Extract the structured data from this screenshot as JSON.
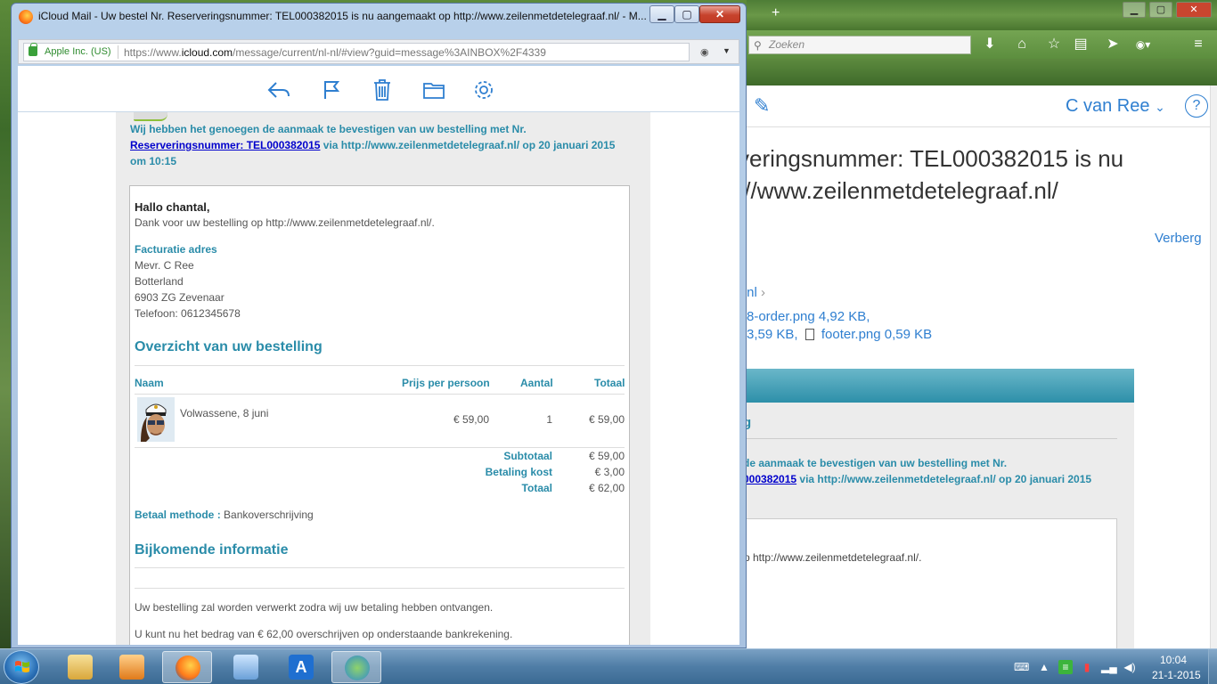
{
  "background_browser": {
    "search_placeholder": "Zoeken",
    "user_name": "C van Ree",
    "user_chevron": "⌄",
    "help_symbol": "?",
    "subject_line1": "veringsnummer: TEL000382015 is nu",
    "subject_line2": "://www.zeilenmetdetelegraaf.nl/",
    "hide_label": "Verberg",
    "from_fragment": ".nl",
    "attachment_line1": "8-order.png 4,92 KB,",
    "attachment_line2_a": "3,59 KB,",
    "attachment_line2_b": "footer.png 0,59 KB",
    "mail_heading_fragment": "g",
    "confirm_line1": "de aanmaak te bevestigen van uw bestelling met Nr.",
    "confirm_link": "000382015",
    "confirm_line2_rest": " via http://www.zeilenmetdetelegraaf.nl/ op 20 januari 2015",
    "box_text": "p http://www.zeilenmetdetelegraaf.nl/."
  },
  "popup": {
    "title": "iCloud Mail - Uw bestel Nr. Reserveringsnummer: TEL000382015 is nu aangemaakt op http://www.zeilenmetdetelegraaf.nl/ - M...",
    "controls": {
      "minimize": "▁",
      "maximize": "▢",
      "close": "✕"
    },
    "identity": "Apple Inc. (US)",
    "url_prefix": "https://www.",
    "url_domain": "icloud.com",
    "url_rest": "/message/current/nl-nl/#view?guid=message%3AINBOX%2F4339"
  },
  "email": {
    "confirm_line1": "Wij hebben het genoegen de aanmaak te bevestigen van uw bestelling met Nr.",
    "confirm_link": "Reserveringsnummer: TEL000382015",
    "confirm_line2_rest": " via http://www.zeilenmetdetelegraaf.nl/ op 20 januari 2015",
    "confirm_line3": "om 10:15",
    "greeting": "Hallo chantal,",
    "thanks": "Dank voor uw bestelling op http://www.zeilenmetdetelegraaf.nl/.",
    "billing_heading": "Facturatie adres",
    "address": [
      "Mevr. C Ree",
      "Botterland",
      "6903 ZG Zevenaar",
      "Telefoon: 0612345678"
    ],
    "overview_heading": "Overzicht van uw bestelling",
    "columns": {
      "name": "Naam",
      "price": "Prijs per persoon",
      "qty": "Aantal",
      "total": "Totaal"
    },
    "item": {
      "name": "Volwassene, 8 juni",
      "price": "€ 59,00",
      "qty": "1",
      "total": "€ 59,00"
    },
    "subtotal_label": "Subtotaal",
    "subtotal_value": "€ 59,00",
    "fee_label": "Betaling kost",
    "fee_value": "€ 3,00",
    "total_label": "Totaal",
    "total_value": "€ 62,00",
    "payment_label": "Betaal methode :",
    "payment_value": " Bankoverschrijving",
    "extra_heading": "Bijkomende informatie",
    "info1": "Uw bestelling zal worden verwerkt zodra wij uw betaling hebben ontvangen.",
    "info2": "U kunt nu het bedrag van € 62,00 overschrijven op onderstaande bankrekening."
  },
  "taskbar": {
    "time": "10:04",
    "date": "21-1-2015"
  }
}
